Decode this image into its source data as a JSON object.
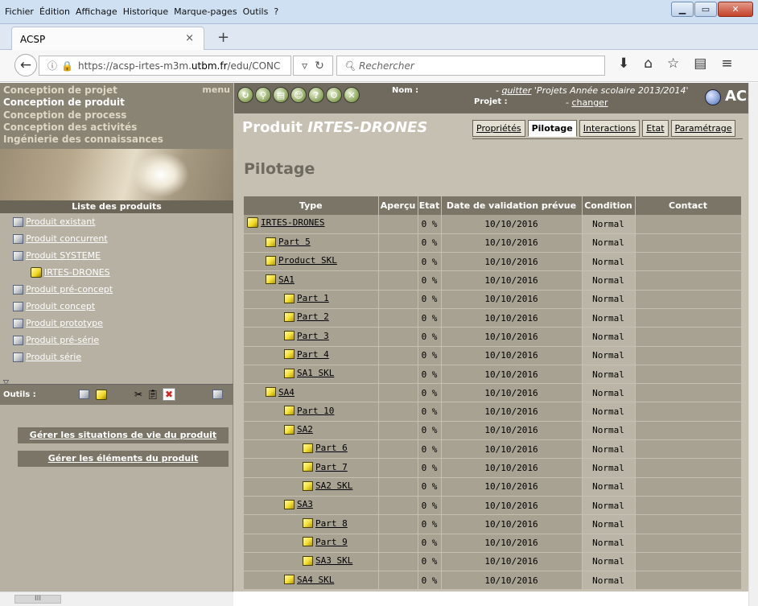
{
  "browser": {
    "menu": [
      "Fichier",
      "Édition",
      "Affichage",
      "Historique",
      "Marque-pages",
      "Outils",
      "?"
    ],
    "tab_title": "ACSP",
    "url_prefix": "https://acsp-irtes-m3m.",
    "url_host": "utbm.fr",
    "url_path": "/edu/CONC",
    "search_placeholder": "Rechercher"
  },
  "sidebar": {
    "categories": [
      "Conception de projet",
      "Conception de produit",
      "Conception de process",
      "Conception des activités",
      "Ingénierie des connaissances"
    ],
    "menu_label": "menu",
    "list_header": "Liste des produits",
    "products": [
      "Produit existant",
      "Produit concurrent",
      "Produit SYSTEME",
      "IRTES-DRONES",
      "Produit pré-concept",
      "Produit concept",
      "Produit prototype",
      "Produit pré-série",
      "Produit série"
    ],
    "tools_label": "Outils :",
    "actions": [
      "Gérer les situations de vie du produit",
      "Gérer les éléments du produit"
    ]
  },
  "header": {
    "nom_label": "Nom :",
    "projet_label": "Projet :",
    "quitter_text": "quitter",
    "project_name": "'Projets Année scolaire 2013/2014'",
    "changer_text": "changer",
    "brand": "ACS"
  },
  "product": {
    "title_prefix": "Produit",
    "name": "IRTES-DRONES",
    "tabs": [
      "Propriétés",
      "Pilotage",
      "Interactions",
      "Etat",
      "Paramétrage"
    ],
    "active_tab": "Pilotage",
    "section_title": "Pilotage"
  },
  "table": {
    "columns": [
      "Type",
      "Aperçu",
      "Etat",
      "Date de validation prévue",
      "Condition",
      "Contact"
    ],
    "rows": [
      {
        "name": "IRTES-DRONES",
        "level": 0,
        "kind": "assembly",
        "etat": "0 %",
        "date": "10/10/2016",
        "condition": "Normal"
      },
      {
        "name": "Part 5",
        "level": 1,
        "kind": "part",
        "etat": "0 %",
        "date": "10/10/2016",
        "condition": "Normal"
      },
      {
        "name": "Product SKL",
        "level": 1,
        "kind": "part",
        "etat": "0 %",
        "date": "10/10/2016",
        "condition": "Normal"
      },
      {
        "name": "SA1",
        "level": 1,
        "kind": "part",
        "etat": "0 %",
        "date": "10/10/2016",
        "condition": "Normal"
      },
      {
        "name": "Part 1",
        "level": 2,
        "kind": "part",
        "etat": "0 %",
        "date": "10/10/2016",
        "condition": "Normal"
      },
      {
        "name": "Part 2",
        "level": 2,
        "kind": "part",
        "etat": "0 %",
        "date": "10/10/2016",
        "condition": "Normal"
      },
      {
        "name": "Part 3",
        "level": 2,
        "kind": "part",
        "etat": "0 %",
        "date": "10/10/2016",
        "condition": "Normal"
      },
      {
        "name": "Part 4",
        "level": 2,
        "kind": "part",
        "etat": "0 %",
        "date": "10/10/2016",
        "condition": "Normal"
      },
      {
        "name": "SA1 SKL",
        "level": 2,
        "kind": "part",
        "etat": "0 %",
        "date": "10/10/2016",
        "condition": "Normal"
      },
      {
        "name": "SA4",
        "level": 1,
        "kind": "part",
        "etat": "0 %",
        "date": "10/10/2016",
        "condition": "Normal"
      },
      {
        "name": "Part 10",
        "level": 2,
        "kind": "part",
        "etat": "0 %",
        "date": "10/10/2016",
        "condition": "Normal"
      },
      {
        "name": "SA2",
        "level": 2,
        "kind": "part",
        "etat": "0 %",
        "date": "10/10/2016",
        "condition": "Normal"
      },
      {
        "name": "Part 6",
        "level": 3,
        "kind": "part",
        "etat": "0 %",
        "date": "10/10/2016",
        "condition": "Normal"
      },
      {
        "name": "Part 7",
        "level": 3,
        "kind": "part",
        "etat": "0 %",
        "date": "10/10/2016",
        "condition": "Normal"
      },
      {
        "name": "SA2 SKL",
        "level": 3,
        "kind": "part",
        "etat": "0 %",
        "date": "10/10/2016",
        "condition": "Normal"
      },
      {
        "name": "SA3",
        "level": 2,
        "kind": "part",
        "etat": "0 %",
        "date": "10/10/2016",
        "condition": "Normal"
      },
      {
        "name": "Part 8",
        "level": 3,
        "kind": "part",
        "etat": "0 %",
        "date": "10/10/2016",
        "condition": "Normal"
      },
      {
        "name": "Part 9",
        "level": 3,
        "kind": "part",
        "etat": "0 %",
        "date": "10/10/2016",
        "condition": "Normal"
      },
      {
        "name": "SA3 SKL",
        "level": 3,
        "kind": "part",
        "etat": "0 %",
        "date": "10/10/2016",
        "condition": "Normal"
      },
      {
        "name": "SA4 SKL",
        "level": 2,
        "kind": "part",
        "etat": "0 %",
        "date": "10/10/2016",
        "condition": "Normal"
      }
    ]
  }
}
